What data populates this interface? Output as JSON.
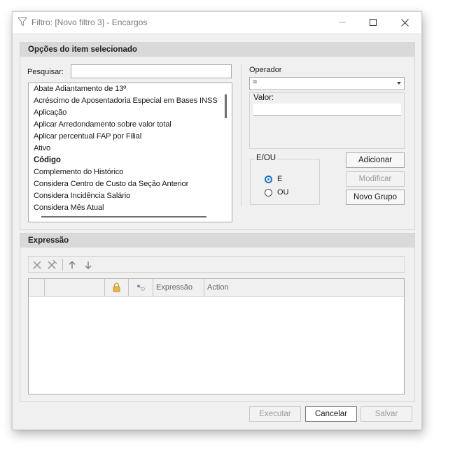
{
  "window": {
    "title": "Filtro: [Novo filtro 3] - Encargos",
    "controls": {
      "minimize": "—",
      "maximize": "☐",
      "close": "✕"
    }
  },
  "options_panel": {
    "header": "Opções do item selecionado",
    "search_label": "Pesquisar:",
    "search_value": "",
    "items": [
      {
        "label": "Abate Adiantamento de 13º",
        "bold": false
      },
      {
        "label": "Acréscimo de Aposentadoria Especial em Bases INSS",
        "bold": false
      },
      {
        "label": "Aplicação",
        "bold": false
      },
      {
        "label": "Aplicar Arredondamento sobre valor total",
        "bold": false
      },
      {
        "label": "Aplicar percentual FAP por Filial",
        "bold": false
      },
      {
        "label": "Ativo",
        "bold": false
      },
      {
        "label": "Código",
        "bold": true
      },
      {
        "label": "Complemento do Histórico",
        "bold": false
      },
      {
        "label": "Considera Centro de Custo da Seção Anterior",
        "bold": false
      },
      {
        "label": "Considera Incidência Salário",
        "bold": false
      },
      {
        "label": "Considera Mês Atual",
        "bold": false
      }
    ],
    "operator_label": "Operador",
    "operator_value": "=",
    "value_label": "Valor:",
    "value_value": "",
    "eou_label": "E/OU",
    "radio_e": "E",
    "radio_ou": "OU",
    "radio_selected": "E",
    "btn_add": "Adicionar",
    "btn_modify": "Modificar",
    "btn_new_group": "Novo Grupo"
  },
  "expression_panel": {
    "header": "Expressão",
    "columns": [
      "",
      "",
      "",
      "",
      "Expressão",
      "Action"
    ],
    "rows": []
  },
  "footer": {
    "btn_execute": "Executar",
    "btn_cancel": "Cancelar",
    "btn_save": "Salvar"
  },
  "colors": {
    "accent": "#1a6fc8",
    "panel_header": "#d9d9d9",
    "window_bg": "#f0f0f0"
  }
}
